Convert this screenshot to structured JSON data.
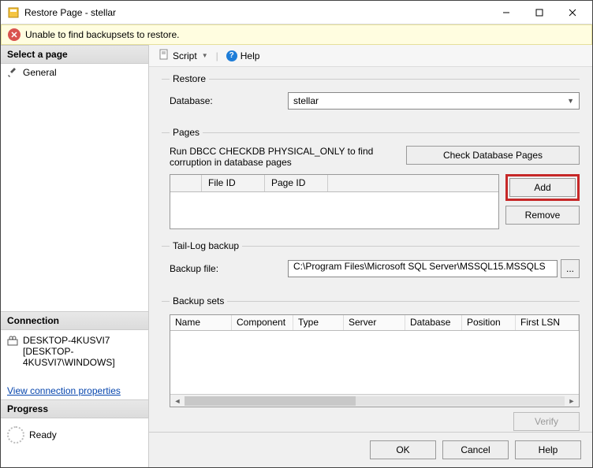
{
  "window": {
    "title": "Restore Page - stellar"
  },
  "message": "Unable to find backupsets to restore.",
  "sidebar": {
    "select_header": "Select a page",
    "general": "General",
    "connection_header": "Connection",
    "conn_line1": "DESKTOP-4KUSVI7",
    "conn_line2": "[DESKTOP-4KUSVI7\\WINDOWS]",
    "view_conn": "View connection properties",
    "progress_header": "Progress",
    "progress_status": "Ready"
  },
  "toolbar": {
    "script": "Script",
    "help": "Help"
  },
  "restore": {
    "legend": "Restore",
    "db_label": "Database:",
    "db_value": "stellar"
  },
  "pages": {
    "legend": "Pages",
    "msg": "Run DBCC CHECKDB PHYSICAL_ONLY to find corruption in database pages",
    "check_btn": "Check Database Pages",
    "col_fileid": "File ID",
    "col_pageid": "Page ID",
    "add_btn": "Add",
    "remove_btn": "Remove"
  },
  "taillog": {
    "legend": "Tail-Log backup",
    "file_label": "Backup file:",
    "file_value": "C:\\Program Files\\Microsoft SQL Server\\MSSQL15.MSSQLS",
    "browse": "..."
  },
  "backupsets": {
    "legend": "Backup sets",
    "cols": {
      "name": "Name",
      "component": "Component",
      "type": "Type",
      "server": "Server",
      "database": "Database",
      "position": "Position",
      "firstlsn": "First LSN"
    },
    "verify": "Verify"
  },
  "footer": {
    "ok": "OK",
    "cancel": "Cancel",
    "help": "Help"
  }
}
